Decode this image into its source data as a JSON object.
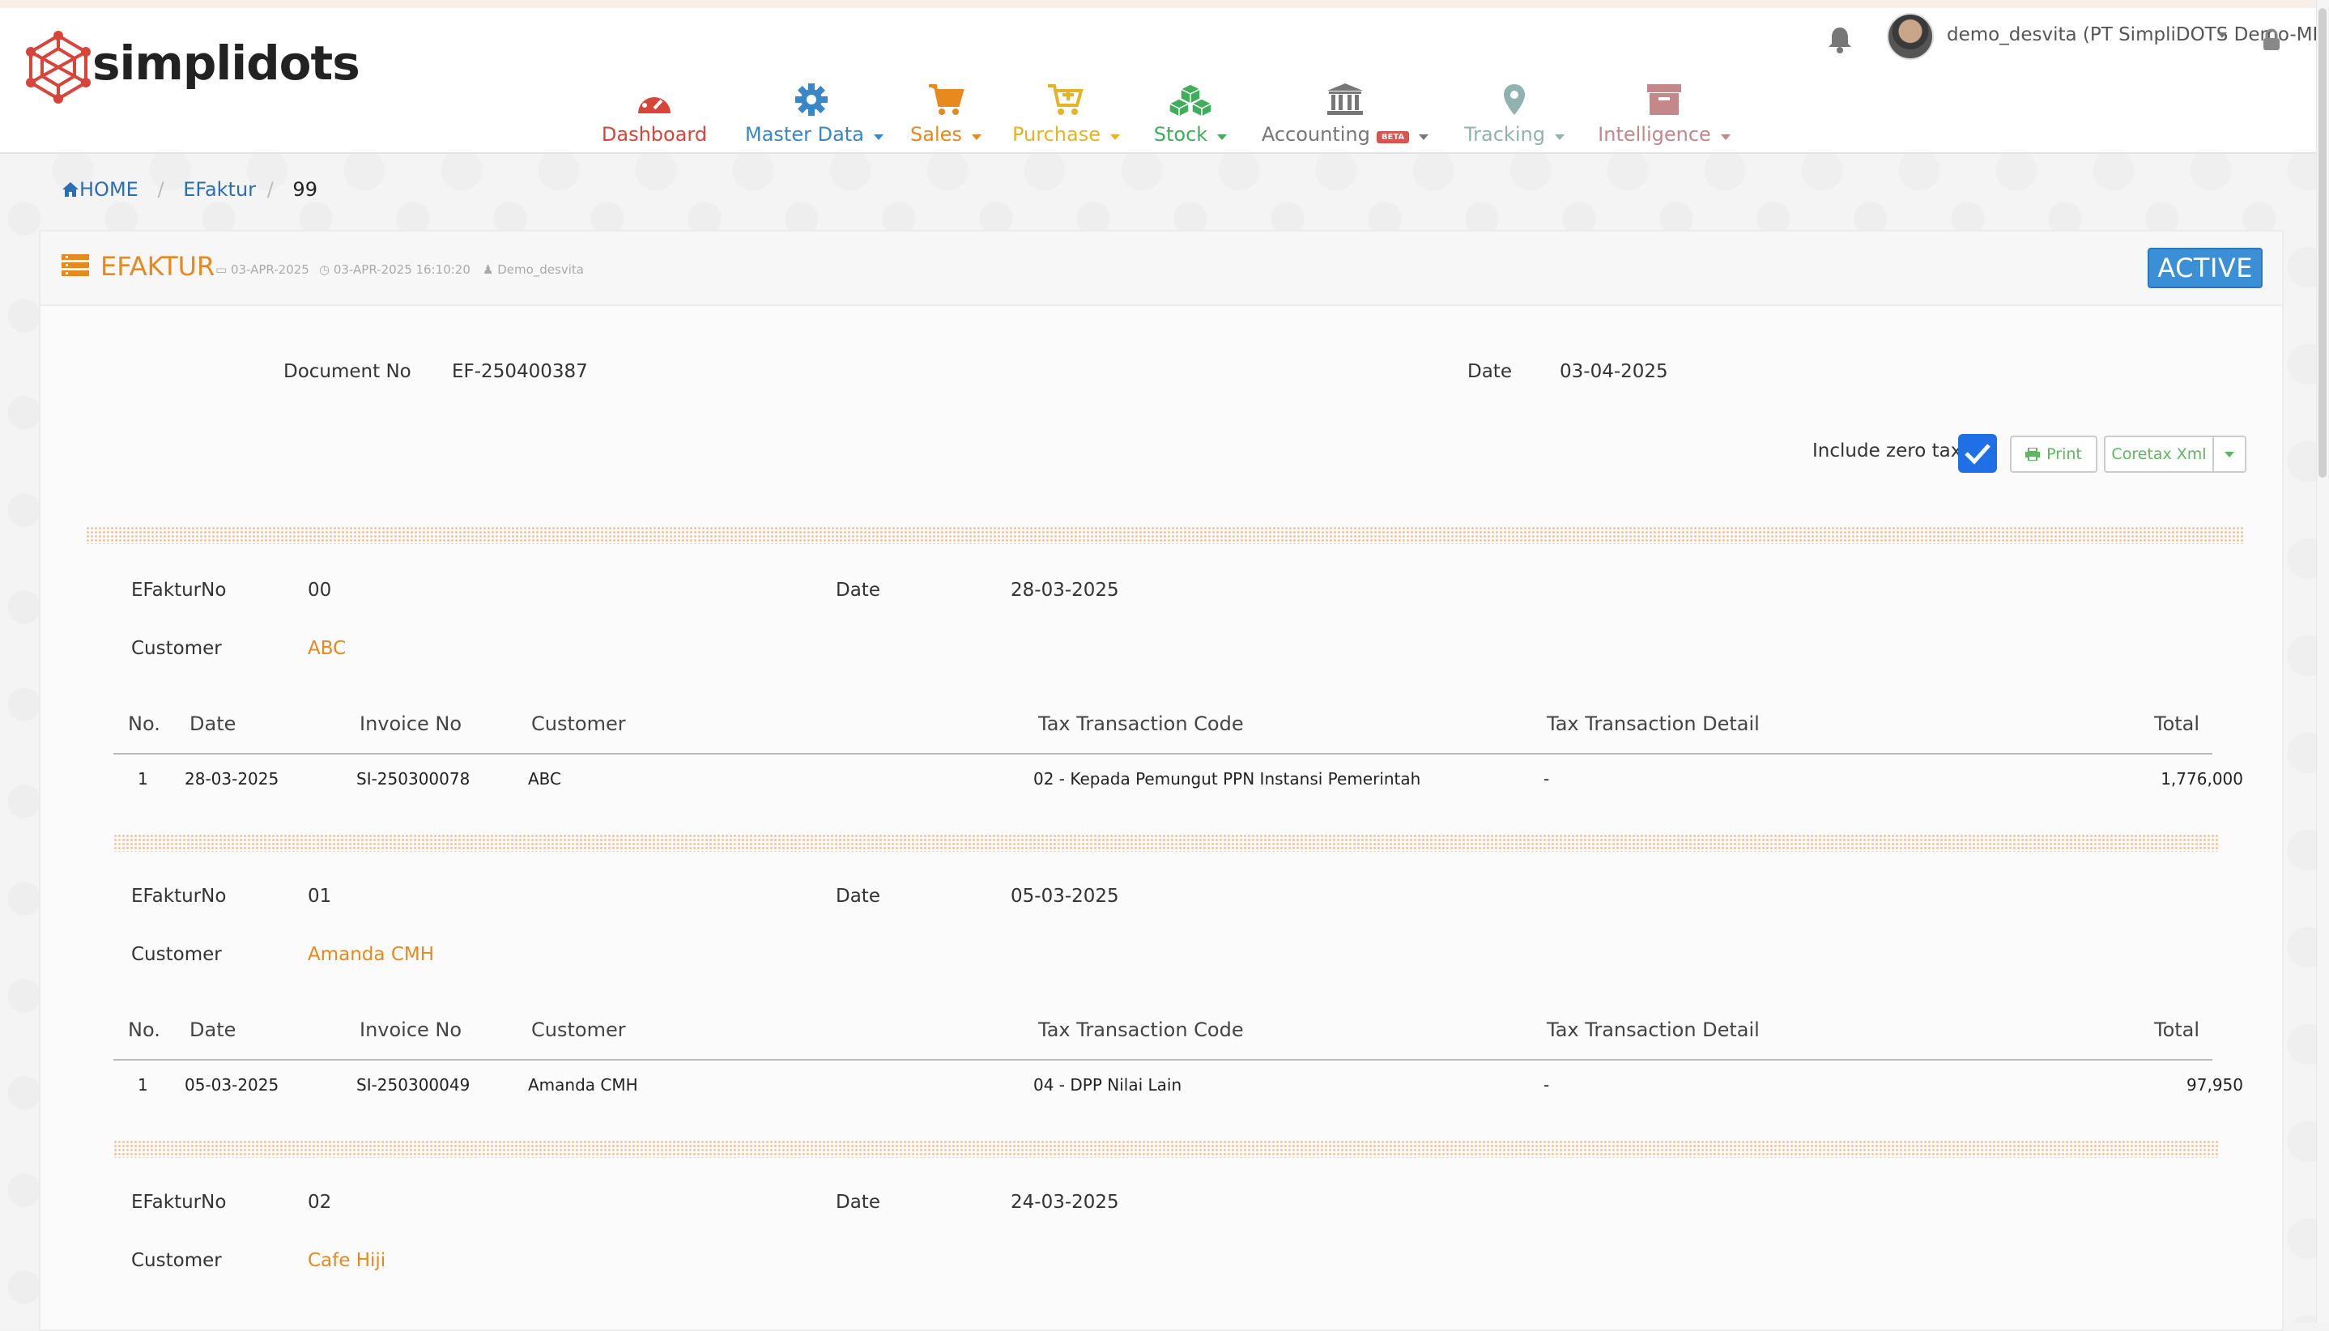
{
  "app": {
    "logo_text": "simplidots"
  },
  "topbar": {
    "user": "demo_desvita (PT SimpliDOTS Demo-MEDAN)"
  },
  "nav": [
    {
      "label": "Dashboard",
      "color": "#d9443a",
      "icon": "speedometer-icon",
      "caret": false
    },
    {
      "label": "Master Data",
      "color": "#3a87c8",
      "icon": "gear-icon",
      "caret": true
    },
    {
      "label": "Sales",
      "color": "#e8891e",
      "icon": "cart-icon",
      "caret": true
    },
    {
      "label": "Purchase",
      "color": "#e6b422",
      "icon": "cart-plus-icon",
      "caret": true
    },
    {
      "label": "Stock",
      "color": "#3fae5a",
      "icon": "cubes-icon",
      "caret": true
    },
    {
      "label": "Accounting",
      "color": "#777777",
      "icon": "bank-icon",
      "caret": true,
      "badge": "BETA"
    },
    {
      "label": "Tracking",
      "color": "#8fb3b0",
      "icon": "map-pin-icon",
      "caret": true
    },
    {
      "label": "Intelligence",
      "color": "#c4878a",
      "icon": "archive-icon",
      "caret": true
    }
  ],
  "breadcrumb": {
    "home": "HOME",
    "section": "EFaktur",
    "current": "99"
  },
  "panel": {
    "title": "EFAKTUR",
    "created_date": "03-APR-2025",
    "modified": "03-APR-2025 16:10:20",
    "user": "Demo_desvita",
    "status": "ACTIVE"
  },
  "document": {
    "doc_no_label": "Document No",
    "doc_no": "EF-250400387",
    "date_label": "Date",
    "date": "03-04-2025",
    "include_zero_tax_label": "Include zero tax",
    "include_zero_tax": true
  },
  "buttons": {
    "print": "Print",
    "coretax": "Coretax Xml"
  },
  "labels": {
    "efaktur_no": "EFakturNo",
    "date": "Date",
    "customer": "Customer"
  },
  "table_headers": [
    "No.",
    "Date",
    "Invoice No",
    "Customer",
    "Tax Transaction Code",
    "Tax Transaction Detail",
    "Total"
  ],
  "efakturs": [
    {
      "no": "00",
      "date": "28-03-2025",
      "customer": "ABC",
      "rows": [
        {
          "no": "1",
          "date": "28-03-2025",
          "invoice": "SI-250300078",
          "customer": "ABC",
          "tax_code": "02 - Kepada Pemungut PPN Instansi Pemerintah",
          "tax_detail": "-",
          "total": "1,776,000"
        }
      ]
    },
    {
      "no": "01",
      "date": "05-03-2025",
      "customer": "Amanda CMH",
      "rows": [
        {
          "no": "1",
          "date": "05-03-2025",
          "invoice": "SI-250300049",
          "customer": "Amanda CMH",
          "tax_code": "04 - DPP Nilai Lain",
          "tax_detail": "-",
          "total": "97,950"
        }
      ]
    },
    {
      "no": "02",
      "date": "24-03-2025",
      "customer": "Cafe Hiji",
      "rows": []
    }
  ]
}
